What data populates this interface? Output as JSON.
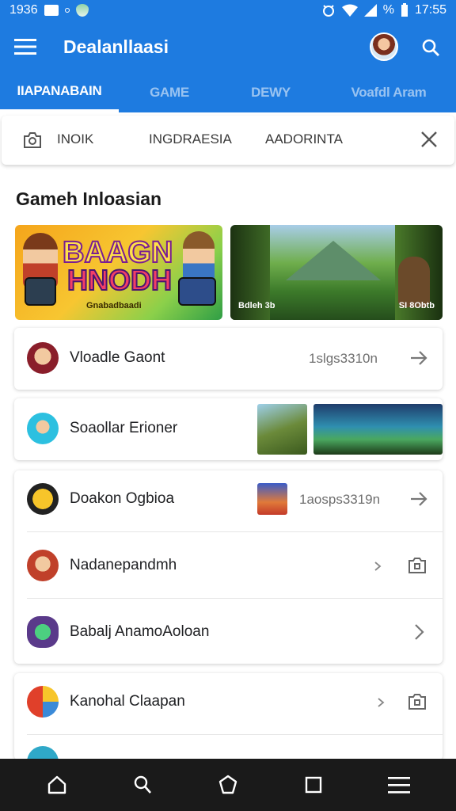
{
  "status_bar": {
    "time_left": "1936",
    "battery_text": "%",
    "clock": "17:55"
  },
  "app_bar": {
    "title": "Dealanllaasi",
    "menu_icon": "menu-icon",
    "avatar_icon": "avatar",
    "search_icon": "search-icon"
  },
  "tabs": [
    {
      "label": "IIAPANABAIN",
      "active": true
    },
    {
      "label": "GAME",
      "active": false
    },
    {
      "label": "DEWY",
      "active": false
    },
    {
      "label": "Voafdl Aram",
      "active": false
    }
  ],
  "filter": {
    "chips": [
      "INOIK",
      "INGDRAESIA",
      "AADORINTA"
    ],
    "close_icon": "close-icon"
  },
  "section": {
    "title": "Gameh Inloasian"
  },
  "banners": [
    {
      "title_line1": "BAAGN",
      "title_line2": "HNODH",
      "subtitle": "Gnabadbaadi"
    },
    {
      "label_left": "Bdleh 3b",
      "label_right": "SI 8Obtb"
    }
  ],
  "list": {
    "items": [
      {
        "label": "Vloadle Gaont",
        "meta": "1slgs3310n",
        "action_icon": "arrow-right-icon"
      },
      {
        "label": "Soaollar Erioner",
        "meta": "",
        "action_icon": ""
      },
      {
        "label": "Doakon Ogbioa",
        "meta": "1aosps3319n",
        "action_icon": "arrow-right-icon"
      },
      {
        "label": "Nadanepandmh",
        "meta": "",
        "action_icon": "camera-icon"
      },
      {
        "label": "Babalj AnamoAoloan",
        "meta": "",
        "action_icon": "chevron-right-icon"
      },
      {
        "label": "Kanohal Claapan",
        "meta": "",
        "action_icon": "camera-icon"
      }
    ]
  },
  "nav_bar": {
    "icons": [
      "home-icon",
      "search-nav-icon",
      "hexagon-icon",
      "square-icon",
      "menu-nav-icon"
    ]
  },
  "colors": {
    "primary": "#1e7be0",
    "nav_bg": "#1a1a1a"
  }
}
